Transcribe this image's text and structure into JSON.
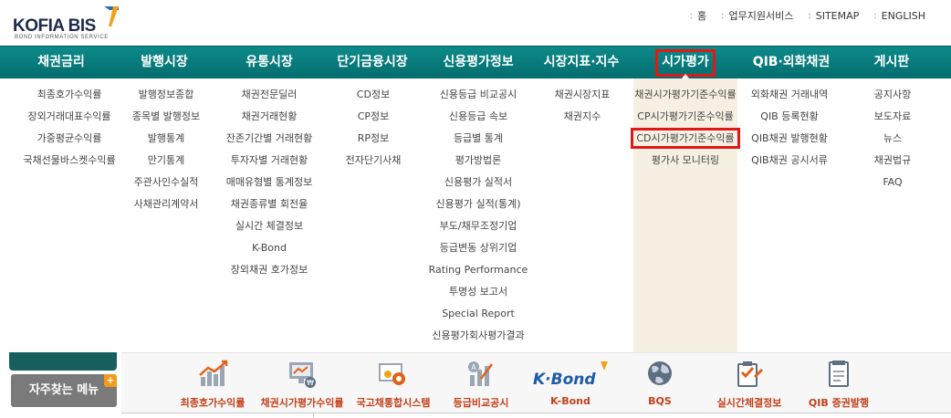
{
  "logo": {
    "name": "KOFIA BIS",
    "sub": "BOND INFORMATION SERVICE"
  },
  "util_links": [
    "홈",
    "업무지원서비스",
    "SITEMAP",
    "ENGLISH"
  ],
  "gnb": [
    "채권금리",
    "발행시장",
    "유통시장",
    "단기금융시장",
    "신용평가정보",
    "시장지표·지수",
    "시가평가",
    "QIB·외화채권",
    "게시판"
  ],
  "submenus": [
    [
      "최종호가수익률",
      "장외거래대표수익률",
      "가중평균수익률",
      "국채선물바스켓수익률"
    ],
    [
      "발행정보종합",
      "종목별 발행정보",
      "발행통계",
      "만기통계",
      "주관사인수실적",
      "사채관리계약서"
    ],
    [
      "채권전문딜러",
      "채권거래현황",
      "잔존기간별 거래현황",
      "투자자별 거래현황",
      "매매유형별 통계정보",
      "채권종류별 회전율",
      "실시간 체결정보",
      "K-Bond",
      "장외채권 호가정보"
    ],
    [
      "CD정보",
      "CP정보",
      "RP정보",
      "전자단기사채"
    ],
    [
      "신용등급 비교공시",
      "신용등급 속보",
      "등급별 통계",
      "평가방법론",
      "신용평가 실적서",
      "신용평가 실적(통계)",
      "부도/채무조정기업",
      "등급변동 상위기업",
      "Rating Performance",
      "투명성 보고서",
      "Special Report",
      "신용평가회사평가결과"
    ],
    [
      "채권시장지표",
      "채권지수"
    ],
    [
      "채권시가평가기준수익률",
      "CP시가평가기준수익률",
      "CD시가평가기준수익률",
      "평가사 모니터링"
    ],
    [
      "외화채권 거래내역",
      "QIB 등록현황",
      "QIB채권 발행현황",
      "QIB채권 공시서류"
    ],
    [
      "공지사항",
      "보도자료",
      "뉴스",
      "채권법규",
      "FAQ"
    ]
  ],
  "favorites_label": "자주찾는 메뉴",
  "quick_menu": [
    {
      "label": "최종호가수익률",
      "icon": "bar-chart-icon"
    },
    {
      "label": "채권시가평가수익률",
      "icon": "monitor-coin-icon"
    },
    {
      "label": "국고채통합시스템",
      "icon": "gear-board-icon"
    },
    {
      "label": "등급비교공시",
      "icon": "rating-compare-icon"
    },
    {
      "label": "K-Bond",
      "icon": "kbond-logo-icon"
    },
    {
      "label": "BQS",
      "icon": "globe-icon"
    },
    {
      "label": "실시간체결정보",
      "icon": "clipboard-check-icon"
    },
    {
      "label": "QIB 증권발행",
      "icon": "document-icon"
    }
  ],
  "colors": {
    "gnb": "#0a7d7e",
    "highlight_box": "#e01818",
    "quick_label": "#c2401a",
    "active_column_bg": "#f6f0e2"
  }
}
